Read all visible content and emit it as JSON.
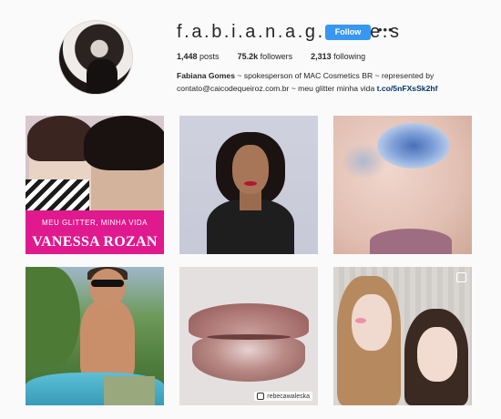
{
  "profile": {
    "username": "f.a.b.i.a.n.a.g.o.m.e.s",
    "follow_label": "Follow",
    "more_label": "•••",
    "posts_count": "1,448",
    "posts_label": "posts",
    "followers_count": "75.2k",
    "followers_label": "followers",
    "following_count": "2,313",
    "following_label": "following",
    "bio_name": "Fabiana Gomes",
    "bio_text": " ~ spokesperson of MAC Cosmetics BR ~ represented by contato@caicodequeiroz.com.br ~ meu glitter minha vida ",
    "bio_link": "t.co/5nFXsSk2hf"
  },
  "posts": [
    {
      "id": 1,
      "subtitle": "MEU GLITTER, MINHA VIDA",
      "title": "VANESSA ROZAN"
    },
    {
      "id": 2
    },
    {
      "id": 3
    },
    {
      "id": 4
    },
    {
      "id": 5,
      "credit": "rebecawaleska",
      "icon": "repost-icon"
    },
    {
      "id": 6,
      "icon": "multiple-posts-icon"
    }
  ],
  "colors": {
    "follow_button": "#3897f0",
    "magazine_band": "#e0198f",
    "link": "#003569"
  }
}
